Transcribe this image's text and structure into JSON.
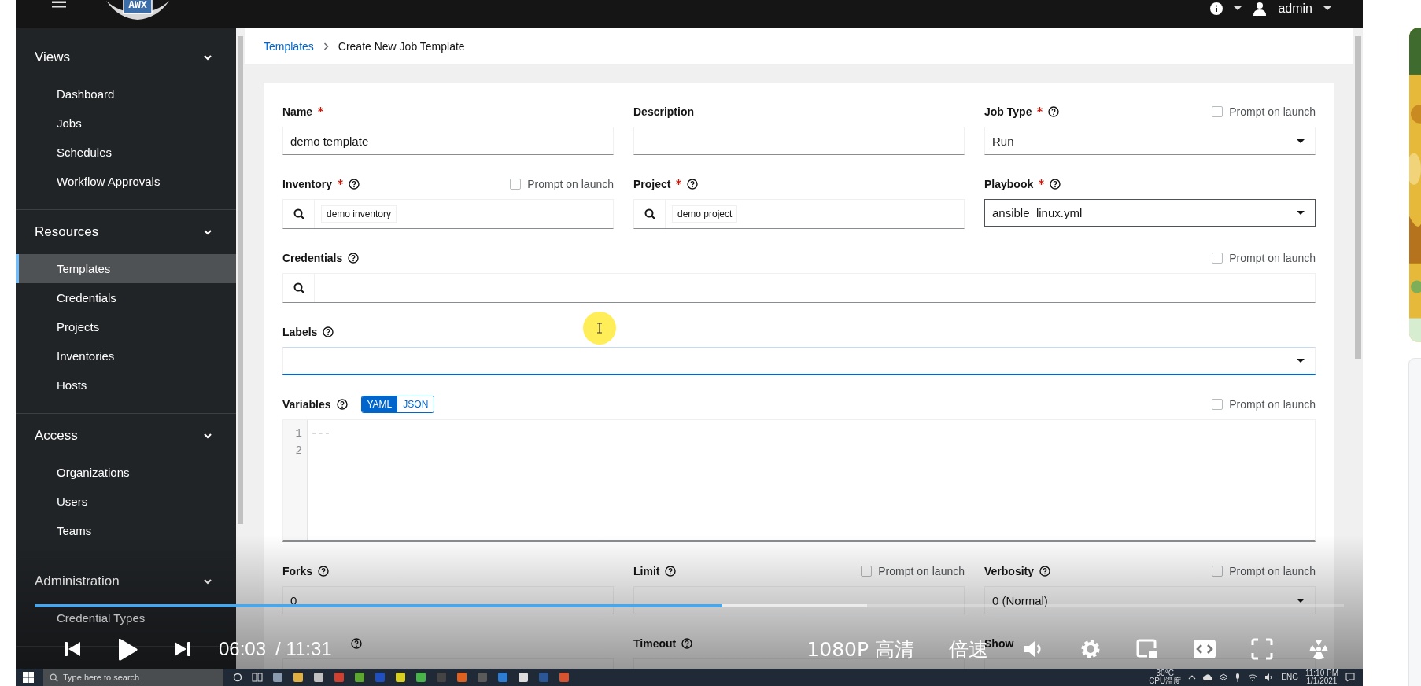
{
  "topbar": {
    "logo": "AWX",
    "user": "admin"
  },
  "sidebar": {
    "groups": [
      {
        "title": "Views",
        "expanded": true,
        "items": [
          {
            "label": "Dashboard",
            "selected": false
          },
          {
            "label": "Jobs",
            "selected": false
          },
          {
            "label": "Schedules",
            "selected": false
          },
          {
            "label": "Workflow Approvals",
            "selected": false
          }
        ]
      },
      {
        "title": "Resources",
        "expanded": true,
        "items": [
          {
            "label": "Templates",
            "selected": true
          },
          {
            "label": "Credentials",
            "selected": false
          },
          {
            "label": "Projects",
            "selected": false
          },
          {
            "label": "Inventories",
            "selected": false
          },
          {
            "label": "Hosts",
            "selected": false
          }
        ]
      },
      {
        "title": "Access",
        "expanded": true,
        "items": [
          {
            "label": "Organizations",
            "selected": false
          },
          {
            "label": "Users",
            "selected": false
          },
          {
            "label": "Teams",
            "selected": false
          }
        ]
      },
      {
        "title": "Administration",
        "expanded": true,
        "items": [
          {
            "label": "Credential Types",
            "selected": false
          }
        ]
      }
    ]
  },
  "breadcrumb": [
    {
      "label": "Templates",
      "kind": "link"
    },
    {
      "label": "Create New Job Template",
      "kind": "current"
    }
  ],
  "form": {
    "rows": [
      [
        {
          "label": "Name",
          "required": true,
          "help": false,
          "kind": "text",
          "value": "demo template",
          "focused": false,
          "hovered": false
        },
        {
          "label": "Description",
          "required": false,
          "help": false,
          "kind": "text",
          "focused": false,
          "hovered": false
        },
        {
          "label": "Job Type",
          "required": true,
          "help": true,
          "kind": "select",
          "value": "Run",
          "focused": false,
          "hovered": false,
          "prompt": {
            "label": "Prompt on launch",
            "checked": false
          }
        }
      ],
      [
        {
          "label": "Inventory",
          "required": true,
          "help": true,
          "kind": "lookup",
          "chip": "demo inventory",
          "focused": false,
          "hovered": false,
          "prompt": {
            "label": "Prompt on launch",
            "checked": false
          }
        },
        {
          "label": "Project",
          "required": true,
          "help": true,
          "kind": "lookup",
          "chip": "demo project",
          "focused": false,
          "hovered": false
        },
        {
          "label": "Playbook",
          "required": true,
          "help": true,
          "kind": "select",
          "value": "ansible_linux.yml",
          "focused": true,
          "hovered": false
        }
      ],
      [
        {
          "label": "Credentials",
          "required": false,
          "help": true,
          "kind": "lookup",
          "focused": false,
          "hovered": false,
          "prompt": {
            "label": "Prompt on launch",
            "checked": false
          }
        }
      ],
      [
        {
          "label": "Labels",
          "required": false,
          "help": true,
          "kind": "select",
          "focused": false,
          "hovered": true
        }
      ],
      [
        {
          "label": "Variables",
          "required": false,
          "help": true,
          "kind": "editor",
          "focused": false,
          "hovered": false,
          "prompt": {
            "label": "Prompt on launch",
            "checked": false
          },
          "format_toggle": [
            {
              "label": "YAML",
              "selected": true
            },
            {
              "label": "JSON",
              "selected": false
            }
          ],
          "lines": [
            {
              "number": "1",
              "code": "---"
            },
            {
              "number": "2"
            }
          ]
        }
      ],
      [
        {
          "label": "Forks",
          "required": false,
          "help": true,
          "kind": "text",
          "value": "0",
          "focused": false,
          "hovered": false
        },
        {
          "label": "Limit",
          "required": false,
          "help": true,
          "kind": "text",
          "focused": false,
          "hovered": false,
          "prompt": {
            "label": "Prompt on launch",
            "checked": false
          }
        },
        {
          "label": "Verbosity",
          "required": false,
          "help": true,
          "kind": "select",
          "value": "0 (Normal)",
          "focused": false,
          "hovered": false,
          "prompt": {
            "label": "Prompt on launch",
            "checked": false
          }
        }
      ],
      [
        {
          "required": false,
          "help": true,
          "kind": "text",
          "focused": false,
          "hovered": false
        },
        {
          "label": "Timeout",
          "required": false,
          "help": true,
          "kind": "text",
          "focused": false,
          "hovered": false
        },
        {
          "label": "Show",
          "required": false,
          "help": false,
          "kind": "text",
          "focused": false,
          "hovered": false
        }
      ]
    ]
  },
  "player": {
    "played": {
      "level": 0.525
    },
    "buffered": {
      "level": 0.636
    },
    "time": "06:03",
    "duration": "/ 11:31",
    "quality": "1080P 高清",
    "speed": "倍速"
  },
  "taskbar": {
    "search_placeholder": "Type here to search",
    "temperature": "30°C",
    "temperature_label": "CPU温度",
    "language": "ENG",
    "time": "11:10 PM",
    "date": "1/1/2021"
  }
}
